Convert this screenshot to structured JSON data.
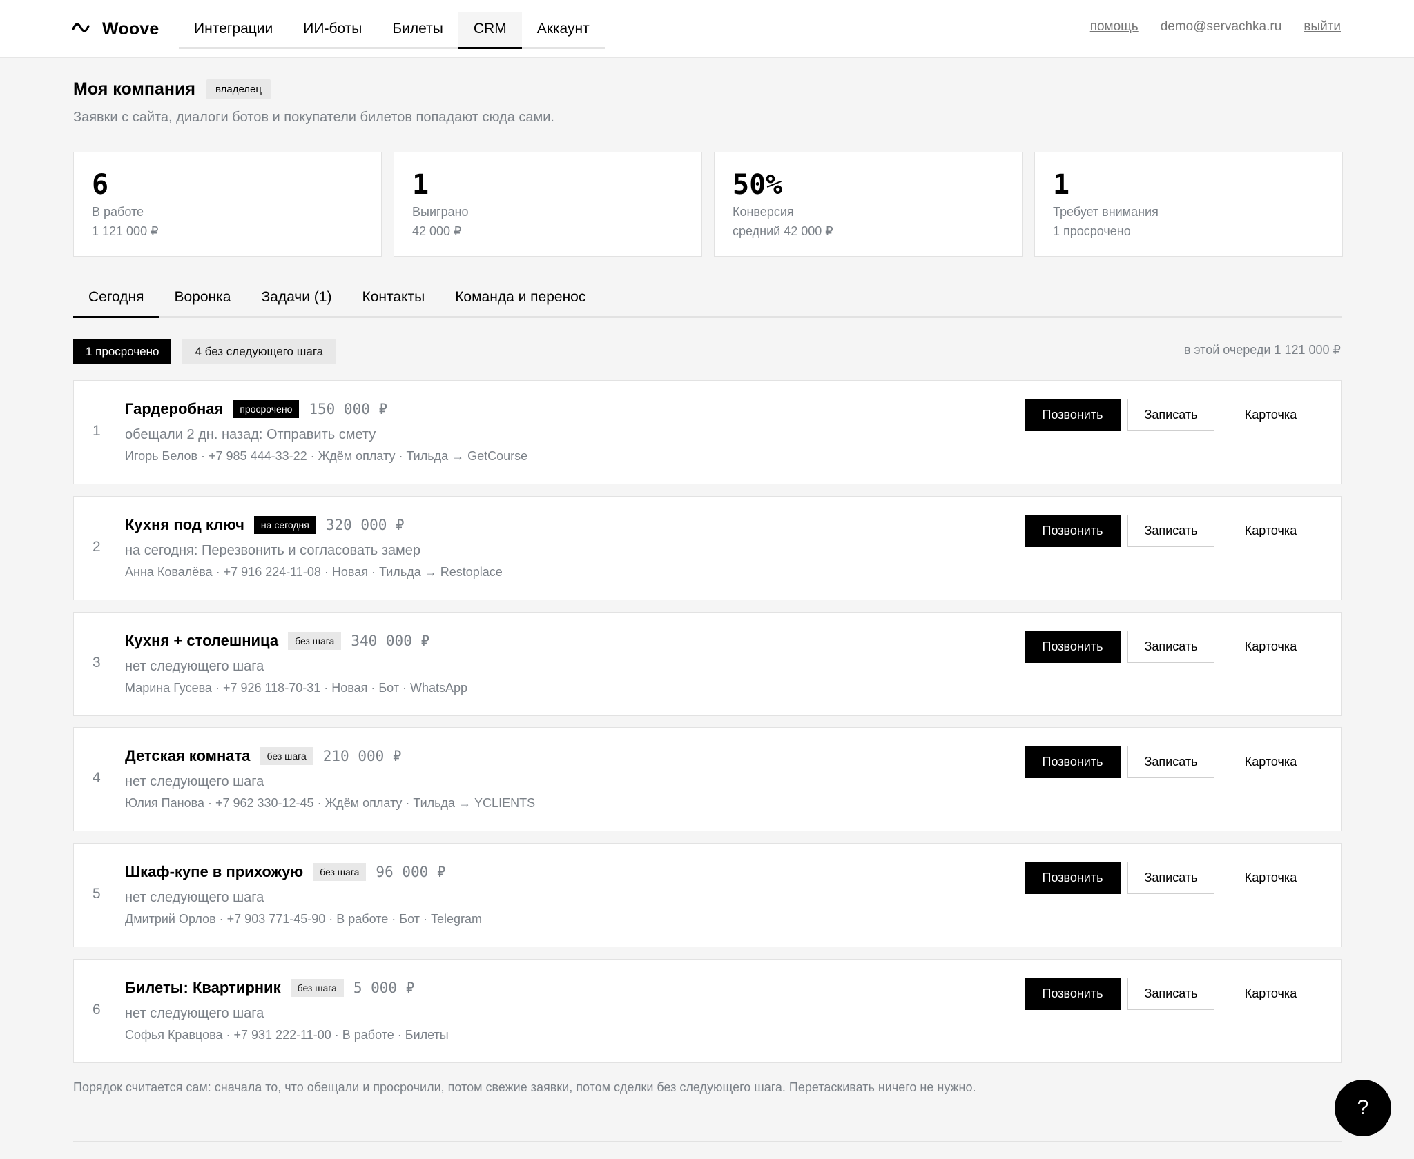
{
  "app": {
    "name": "Woove",
    "logo_icon": "wave-icon"
  },
  "nav": [
    {
      "label": "Интеграции",
      "active": false
    },
    {
      "label": "ИИ-боты",
      "active": false
    },
    {
      "label": "Билеты",
      "active": false
    },
    {
      "label": "CRM",
      "active": true
    },
    {
      "label": "Аккаунт",
      "active": false
    }
  ],
  "top": {
    "help": "помощь",
    "email": "demo@servachka.ru",
    "logout": "выйти"
  },
  "company": {
    "title": "Моя компания",
    "role": "владелец",
    "subtitle": "Заявки с сайта, диалоги ботов и покупатели билетов попадают сюда сами."
  },
  "stats": [
    {
      "value": "6",
      "label": "В работе",
      "sub": "1 121 000 ₽"
    },
    {
      "value": "1",
      "label": "Выиграно",
      "sub": "42 000 ₽"
    },
    {
      "value": "50%",
      "label": "Конверсия",
      "sub": "средний 42 000 ₽"
    },
    {
      "value": "1",
      "label": "Требует внимания",
      "sub": "1 просрочено"
    }
  ],
  "tabs": [
    {
      "label": "Сегодня",
      "active": true
    },
    {
      "label": "Воронка",
      "active": false
    },
    {
      "label": "Задачи (1)",
      "active": false
    },
    {
      "label": "Контакты",
      "active": false
    },
    {
      "label": "Команда и перенос",
      "active": false
    }
  ],
  "filters": {
    "overdue": "1 просрочено",
    "no_next": "4 без следующего шага",
    "queue_total": "в этой очереди 1 121 000 ₽"
  },
  "actions": {
    "call": "Позвонить",
    "record": "Записать",
    "card": "Карточка"
  },
  "deals": [
    {
      "num": "1",
      "title": "Гардеробная",
      "badge": "просрочено",
      "badge_style": "dark",
      "amount": "150 000 ₽",
      "next": "обещали 2 дн. назад: Отправить смету",
      "meta": "Игорь Белов · +7 985 444-33-22 · Ждём оплату · Тильда → GetCourse"
    },
    {
      "num": "2",
      "title": "Кухня под ключ",
      "badge": "на сегодня",
      "badge_style": "dark",
      "amount": "320 000 ₽",
      "next": "на сегодня: Перезвонить и согласовать замер",
      "meta": "Анна Ковалёва · +7 916 224-11-08 · Новая · Тильда → Restoplace"
    },
    {
      "num": "3",
      "title": "Кухня + столешница",
      "badge": "без шага",
      "badge_style": "light",
      "amount": "340 000 ₽",
      "next": "нет следующего шага",
      "meta": "Марина Гусева · +7 926 118-70-31 · Новая · Бот · WhatsApp"
    },
    {
      "num": "4",
      "title": "Детская комната",
      "badge": "без шага",
      "badge_style": "light",
      "amount": "210 000 ₽",
      "next": "нет следующего шага",
      "meta": "Юлия Панова · +7 962 330-12-45 · Ждём оплату · Тильда → YCLIENTS"
    },
    {
      "num": "5",
      "title": "Шкаф-купе в прихожую",
      "badge": "без шага",
      "badge_style": "light",
      "amount": "96 000 ₽",
      "next": "нет следующего шага",
      "meta": "Дмитрий Орлов · +7 903 771-45-90 · В работе · Бот · Telegram"
    },
    {
      "num": "6",
      "title": "Билеты: Квартирник",
      "badge": "без шага",
      "badge_style": "light",
      "amount": "5 000 ₽",
      "next": "нет следующего шага",
      "meta": "Софья Кравцова · +7 931 222-11-00 · В работе · Билеты"
    }
  ],
  "footnote": "Порядок считается сам: сначала то, что обещали и просрочили, потом свежие заявки, потом сделки без следующего шага. Перетаскивать ничего не нужно.",
  "help_fab": "?"
}
